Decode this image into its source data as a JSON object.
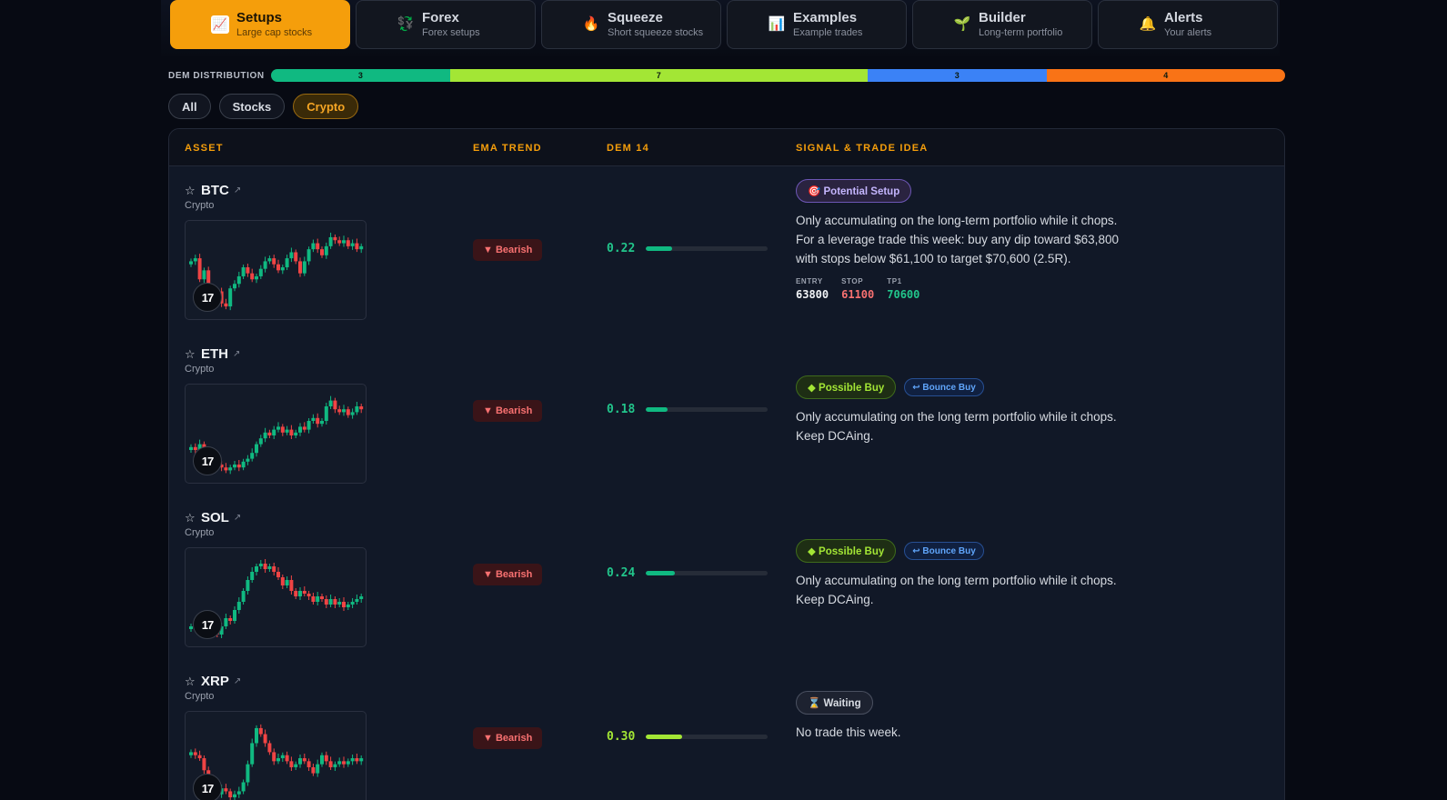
{
  "tabs": [
    {
      "title": "Setups",
      "subtitle": "Large cap stocks",
      "icon": "chart-icon",
      "glyph": "📈",
      "active": true
    },
    {
      "title": "Forex",
      "subtitle": "Forex setups",
      "icon": "exchange-icon",
      "glyph": "💱",
      "active": false
    },
    {
      "title": "Squeeze",
      "subtitle": "Short squeeze stocks",
      "icon": "fire-icon",
      "glyph": "🔥",
      "active": false
    },
    {
      "title": "Examples",
      "subtitle": "Example trades",
      "icon": "bar-chart-icon",
      "glyph": "📊",
      "active": false
    },
    {
      "title": "Builder",
      "subtitle": "Long-term portfolio",
      "icon": "seedling-icon",
      "glyph": "🌱",
      "active": false
    },
    {
      "title": "Alerts",
      "subtitle": "Your alerts",
      "icon": "bell-icon",
      "glyph": "🔔",
      "active": false
    }
  ],
  "distribution": {
    "label": "DEM DISTRIBUTION",
    "segments": [
      {
        "count": "3",
        "color": "#10b981"
      },
      {
        "count": "7",
        "color": "#a3e635"
      },
      {
        "count": "3",
        "color": "#3b82f6"
      },
      {
        "count": "4",
        "color": "#f97316"
      }
    ]
  },
  "filters": [
    {
      "label": "All",
      "active": false
    },
    {
      "label": "Stocks",
      "active": false
    },
    {
      "label": "Crypto",
      "active": true
    }
  ],
  "table": {
    "headers": {
      "asset": "ASSET",
      "ema": "EMA TREND",
      "dem": "DEM 14",
      "signal": "SIGNAL & TRADE IDEA"
    },
    "rows": [
      {
        "ticker": "BTC",
        "type": "Crypto",
        "trend": "▼ Bearish",
        "dem": "0.22",
        "dem_fraction": 0.22,
        "badges": [
          {
            "label": "🎯 Potential Setup",
            "kind": "setup"
          }
        ],
        "idea": "Only accumulating on the long-term portfolio while it chops. For a leverage trade this week: buy any dip toward $63,800 with stops below $61,100 to target $70,600 (2.5R).",
        "levels": [
          {
            "label": "ENTRY",
            "value": "63800",
            "color": "#f1f3f6"
          },
          {
            "label": "STOP",
            "value": "61100",
            "color": "#f87171"
          },
          {
            "label": "TP1",
            "value": "70600",
            "color": "#22c58b"
          }
        ],
        "spark": [
          70,
          72,
          58,
          64,
          48,
          45,
          50,
          42,
          40,
          52,
          55,
          60,
          66,
          62,
          58,
          60,
          65,
          70,
          72,
          68,
          64,
          66,
          72,
          76,
          70,
          62,
          70,
          78,
          82,
          78,
          74,
          80,
          86,
          84,
          82,
          84,
          80,
          82,
          78,
          80
        ]
      },
      {
        "ticker": "ETH",
        "type": "Crypto",
        "trend": "▼ Bearish",
        "dem": "0.18",
        "dem_fraction": 0.18,
        "badges": [
          {
            "label": "◆ Possible Buy",
            "kind": "buy"
          },
          {
            "label": "↩ Bounce Buy",
            "kind": "bounce"
          }
        ],
        "idea": "Only accumulating on the long term portfolio while it chops. Keep DCAing.",
        "levels": [],
        "spark": [
          52,
          50,
          54,
          48,
          46,
          44,
          40,
          38,
          36,
          38,
          40,
          38,
          42,
          44,
          48,
          54,
          58,
          62,
          60,
          64,
          66,
          62,
          64,
          60,
          62,
          66,
          64,
          70,
          72,
          68,
          70,
          80,
          84,
          78,
          76,
          78,
          74,
          76,
          80,
          78
        ]
      },
      {
        "ticker": "SOL",
        "type": "Crypto",
        "trend": "▼ Bearish",
        "dem": "0.24",
        "dem_fraction": 0.24,
        "badges": [
          {
            "label": "◆ Possible Buy",
            "kind": "buy"
          },
          {
            "label": "↩ Bounce Buy",
            "kind": "bounce"
          }
        ],
        "idea": "Only accumulating on the long term portfolio while it chops. Keep DCAing.",
        "levels": [],
        "spark": [
          44,
          48,
          50,
          46,
          42,
          40,
          38,
          44,
          50,
          48,
          56,
          62,
          70,
          78,
          84,
          88,
          90,
          86,
          88,
          84,
          80,
          74,
          78,
          70,
          66,
          70,
          68,
          66,
          62,
          66,
          64,
          60,
          64,
          60,
          62,
          58,
          60,
          62,
          64,
          66
        ]
      },
      {
        "ticker": "XRP",
        "type": "Crypto",
        "trend": "▼ Bearish",
        "dem": "0.30",
        "dem_fraction": 0.3,
        "badges": [
          {
            "label": "⌛ Waiting",
            "kind": "wait"
          }
        ],
        "idea": "No trade this week.",
        "levels": [],
        "spark": [
          64,
          62,
          60,
          52,
          46,
          40,
          36,
          40,
          38,
          34,
          36,
          38,
          44,
          56,
          70,
          80,
          76,
          70,
          64,
          58,
          60,
          62,
          58,
          54,
          56,
          60,
          58,
          54,
          50,
          56,
          62,
          58,
          54,
          56,
          58,
          56,
          58,
          60,
          58,
          60
        ]
      }
    ]
  }
}
